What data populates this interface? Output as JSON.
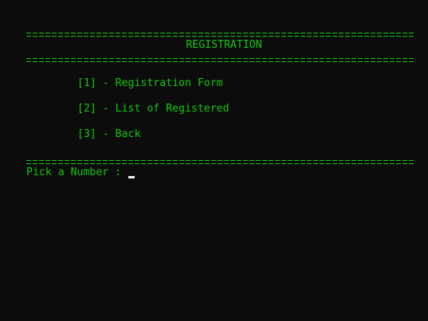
{
  "screen": {
    "title": "REGISTRATION",
    "menu": [
      {
        "label": "[1] - Registration Form"
      },
      {
        "label": "[2] - List of Registered"
      },
      {
        "label": "[3] - Back"
      }
    ],
    "prompt": "Pick a Number : ",
    "colors": {
      "background": "#0c0c0c",
      "text": "#16c60c",
      "cursor": "#f2f2f2"
    }
  }
}
